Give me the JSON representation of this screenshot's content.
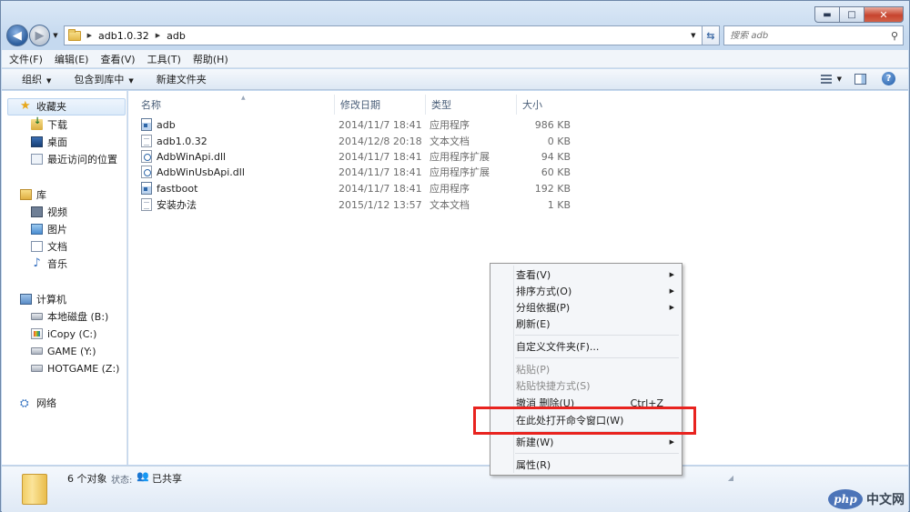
{
  "window": {
    "caption_minimize": "▬",
    "caption_maximize": "□",
    "caption_close": "✕"
  },
  "address": {
    "crumbs": [
      "adb1.0.32",
      "adb"
    ]
  },
  "search": {
    "placeholder": "搜索 adb"
  },
  "menubar": {
    "items": [
      "文件(F)",
      "编辑(E)",
      "查看(V)",
      "工具(T)",
      "帮助(H)"
    ]
  },
  "commandbar": {
    "organize": "组织",
    "include_library": "包含到库中",
    "new_folder": "新建文件夹",
    "help": "?"
  },
  "navpane": {
    "favorites": "收藏夹",
    "fav_items": [
      "下载",
      "桌面",
      "最近访问的位置"
    ],
    "libraries": "库",
    "lib_items": [
      "视频",
      "图片",
      "文档",
      "音乐"
    ],
    "computer": "计算机",
    "drives": [
      "本地磁盘 (B:)",
      "iCopy (C:)",
      "GAME (Y:)",
      "HOTGAME (Z:)"
    ],
    "network": "网络"
  },
  "columns": {
    "name": "名称",
    "date": "修改日期",
    "type": "类型",
    "size": "大小"
  },
  "files": [
    {
      "name": "adb",
      "date": "2014/11/7 18:41",
      "type": "应用程序",
      "size": "986 KB",
      "icon": "exe-icon"
    },
    {
      "name": "adb1.0.32",
      "date": "2014/12/8 20:18",
      "type": "文本文档",
      "size": "0 KB",
      "icon": "text-file-icon"
    },
    {
      "name": "AdbWinApi.dll",
      "date": "2014/11/7 18:41",
      "type": "应用程序扩展",
      "size": "94 KB",
      "icon": "dll-icon"
    },
    {
      "name": "AdbWinUsbApi.dll",
      "date": "2014/11/7 18:41",
      "type": "应用程序扩展",
      "size": "60 KB",
      "icon": "dll-icon"
    },
    {
      "name": "fastboot",
      "date": "2014/11/7 18:41",
      "type": "应用程序",
      "size": "192 KB",
      "icon": "exe-icon"
    },
    {
      "name": "安装办法",
      "date": "2015/1/12 13:57",
      "type": "文本文档",
      "size": "1 KB",
      "icon": "text-file-icon"
    }
  ],
  "context_menu": {
    "view": "查看(V)",
    "sort": "排序方式(O)",
    "group": "分组依据(P)",
    "refresh": "刷新(E)",
    "customize": "自定义文件夹(F)...",
    "paste": "粘贴(P)",
    "paste_shortcut": "粘贴快捷方式(S)",
    "undo_delete": "撤消 删除(U)",
    "undo_shortcut": "Ctrl+Z",
    "open_cmd": "在此处打开命令窗口(W)",
    "new": "新建(W)",
    "properties": "属性(R)"
  },
  "details": {
    "count": "6 个对象",
    "state_label": "状态:",
    "share": "已共享"
  },
  "watermark": {
    "logo": "php",
    "text": "中文网"
  },
  "colors": {
    "highlight_box": "#e8231f",
    "selection": "#dbeaf9"
  }
}
